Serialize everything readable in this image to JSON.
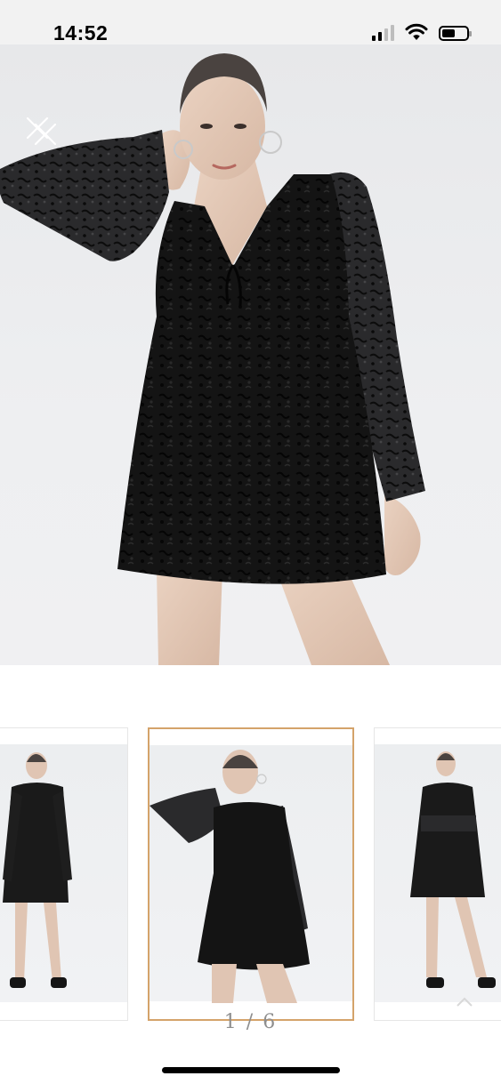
{
  "status_bar": {
    "time": "14:52",
    "icons": [
      "cellular-signal-icon",
      "wifi-icon",
      "battery-icon"
    ],
    "battery_level": 0.55
  },
  "hero": {
    "image": "model-black-lace-romper-front",
    "close_icon": "close-icon"
  },
  "gallery": {
    "counter": "1 / 6",
    "current": 1,
    "total": 6,
    "accent_color": "#d4a36a",
    "thumbnails": [
      {
        "pose": "full-body-front"
      },
      {
        "pose": "hand-behind-head"
      },
      {
        "pose": "full-body-arms-crossed"
      }
    ]
  },
  "colors": {
    "garment": "#111111",
    "background": "#eeeff1",
    "status_bar": "#f2f2f2"
  }
}
